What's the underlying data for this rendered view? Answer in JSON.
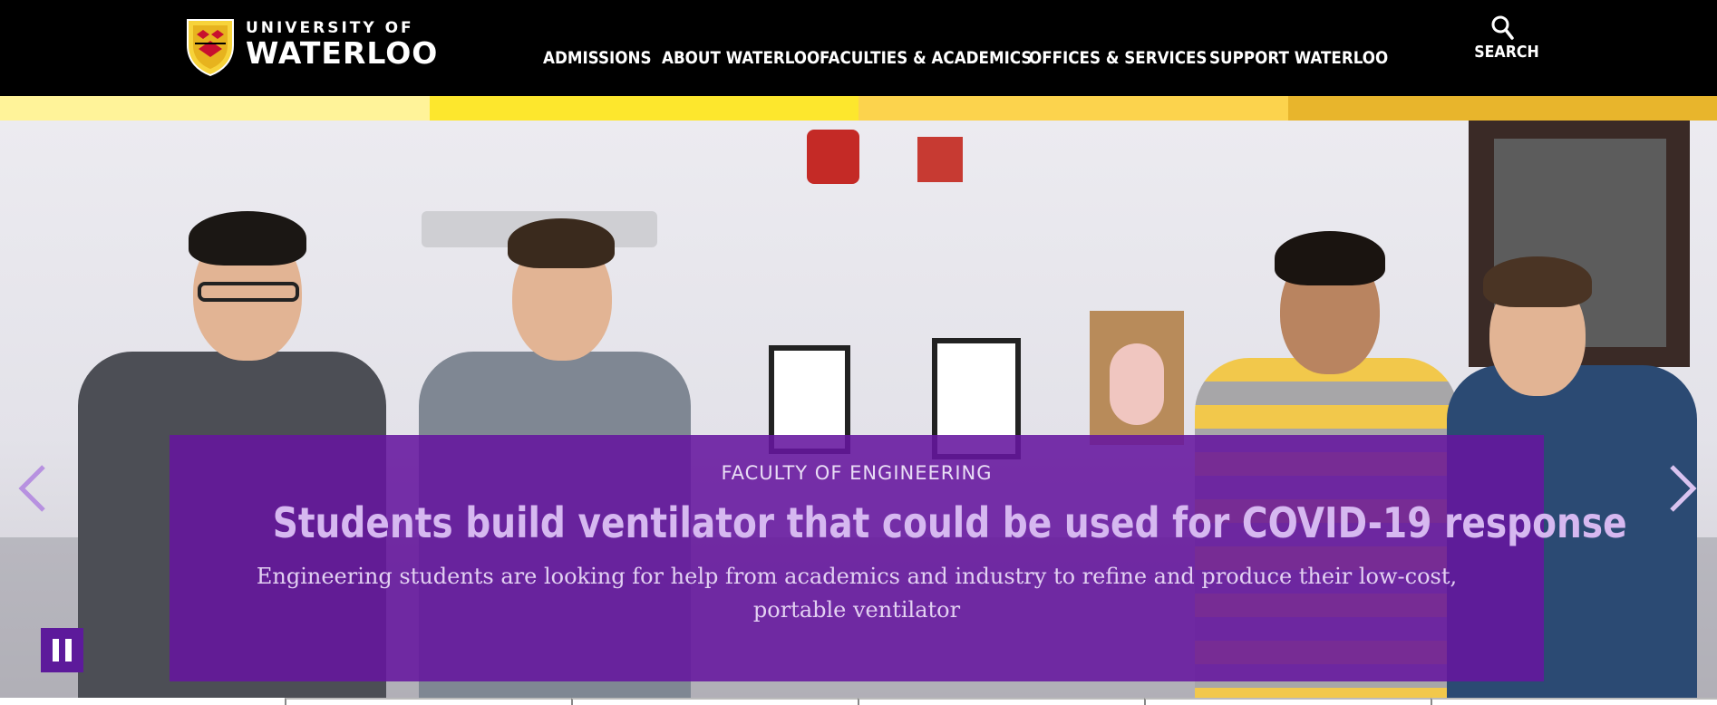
{
  "brand": {
    "line1": "UNIVERSITY OF",
    "line2": "WATERLOO",
    "colors": {
      "header_bg": "#000000",
      "accent_purple": "#65169e"
    }
  },
  "nav": {
    "items": [
      {
        "label": "ADMISSIONS"
      },
      {
        "label": "ABOUT WATERLOO"
      },
      {
        "label": "FACULTIES & ACADEMICS"
      },
      {
        "label": "OFFICES & SERVICES"
      },
      {
        "label": "SUPPORT WATERLOO"
      }
    ]
  },
  "search": {
    "label": "SEARCH",
    "icon": "search-icon"
  },
  "stripe": {
    "colors": [
      "#fff399",
      "#fde72d",
      "#fcd34d",
      "#e8b52c"
    ]
  },
  "slide": {
    "kicker": "FACULTY OF ENGINEERING",
    "title": "Students build ventilator that could be used for COVID-19 response",
    "description": "Engineering students are looking for help from academics and industry to refine and produce their low-cost, portable ventilator"
  },
  "controls": {
    "prev_icon": "chevron-left-icon",
    "next_icon": "chevron-right-icon",
    "pause_icon": "pause-icon"
  }
}
